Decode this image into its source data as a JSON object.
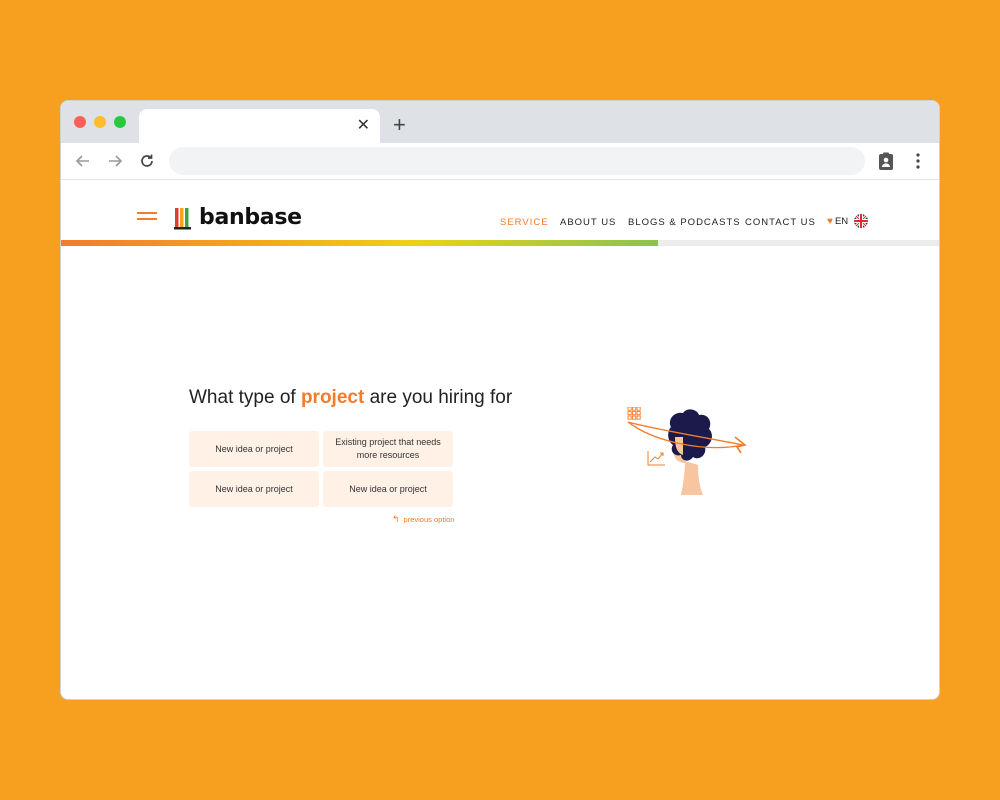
{
  "browser": {
    "tab_title": "",
    "tab_close": "✕",
    "new_tab": "+",
    "address": ""
  },
  "site": {
    "logo_text": "banbase",
    "nav": {
      "service": "SERVICE",
      "about": "ABOUT US",
      "blogs": "BLOGS & PODCASTS",
      "contact": "CONTACT US"
    },
    "language": "EN",
    "accent_color": "#F47B2A",
    "progress": 0.68
  },
  "question": {
    "before": "What type of ",
    "highlight": "project",
    "after": " are you hiring for"
  },
  "options": [
    "New idea or project",
    "Existing project that needs more resources",
    "New idea or project",
    "New idea or project"
  ],
  "previous_option": "previous option",
  "colors": {
    "background": "#F79F1F",
    "option_bg": "#FFF1E6",
    "hair": "#1C1A4A",
    "skin": "#F7C59F"
  }
}
